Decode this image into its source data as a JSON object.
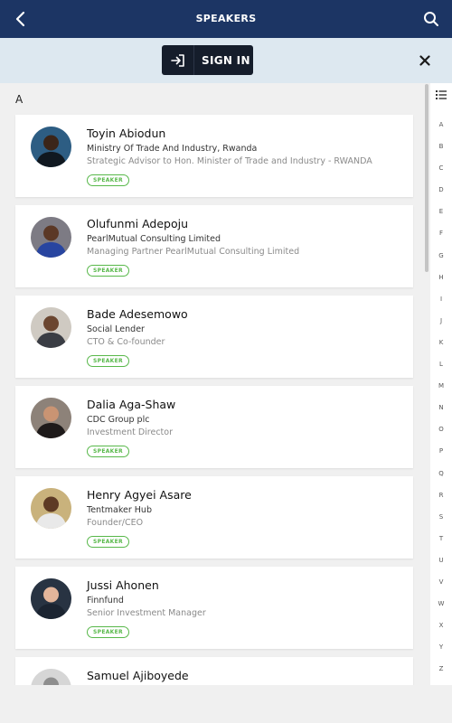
{
  "header": {
    "title": "SPEAKERS"
  },
  "banner": {
    "signin_label": "SIGN IN"
  },
  "list": {
    "section_letter": "A",
    "badge_label": "SPEAKER",
    "speakers": [
      {
        "name": "Toyin Abiodun",
        "org": "Ministry Of Trade And Industry, Rwanda",
        "role": "Strategic Advisor to Hon. Minister of Trade and Industry - RWANDA",
        "skin": "#3b2519",
        "bg": "#2d5d83",
        "shirt": "#101820"
      },
      {
        "name": "Olufunmi Adepoju",
        "org": "PearlMutual Consulting Limited",
        "role": "Managing Partner PearlMutual Consulting Limited",
        "skin": "#5b3826",
        "bg": "#7d7b84",
        "shirt": "#2845a0"
      },
      {
        "name": "Bade Adesemowo",
        "org": "Social Lender",
        "role": "CTO & Co-founder",
        "skin": "#6b4630",
        "bg": "#cfcac2",
        "shirt": "#3a3d44"
      },
      {
        "name": "Dalia Aga-Shaw",
        "org": "CDC Group plc",
        "role": "Investment Director",
        "skin": "#c99473",
        "bg": "#8d8279",
        "shirt": "#1e1a1a"
      },
      {
        "name": "Henry Agyei Asare",
        "org": "Tentmaker Hub",
        "role": "Founder/CEO",
        "skin": "#5d3a24",
        "bg": "#c9b27c",
        "shirt": "#e9e9e9"
      },
      {
        "name": "Jussi Ahonen",
        "org": "Finnfund",
        "role": "Senior Investment Manager",
        "skin": "#e3b59a",
        "bg": "#283342",
        "shirt": "#1b2431"
      },
      {
        "name": "Samuel Ajiboyede",
        "org": "",
        "role": "",
        "skin": "#8e8e8e",
        "bg": "#d6d6d6",
        "shirt": "#8e8e8e"
      }
    ]
  },
  "index": {
    "letters": [
      "A",
      "B",
      "C",
      "D",
      "E",
      "F",
      "G",
      "H",
      "I",
      "J",
      "K",
      "L",
      "M",
      "N",
      "O",
      "P",
      "Q",
      "R",
      "S",
      "T",
      "U",
      "V",
      "W",
      "X",
      "Y",
      "Z"
    ]
  }
}
